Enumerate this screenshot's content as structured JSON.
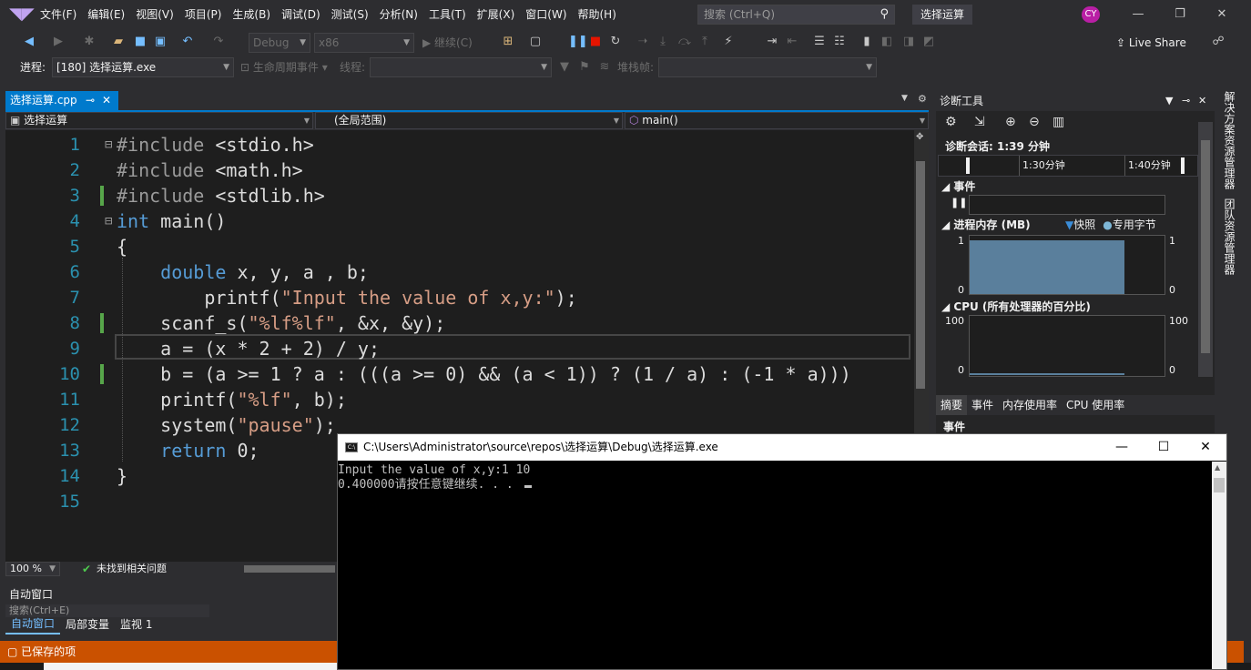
{
  "menubar": {
    "items": [
      "文件(F)",
      "编辑(E)",
      "视图(V)",
      "项目(P)",
      "生成(B)",
      "调试(D)",
      "测试(S)",
      "分析(N)",
      "工具(T)",
      "扩展(X)",
      "窗口(W)",
      "帮助(H)"
    ],
    "search_placeholder": "搜索 (Ctrl+Q)",
    "project_title": "选择运算",
    "user_initials": "CY"
  },
  "toolbar": {
    "config": "Debug",
    "platform": "x86",
    "continue_label": "继续(C)",
    "live_share": "Live Share"
  },
  "debug_location": {
    "process_label": "进程:",
    "process_value": "[180] 选择运算.exe",
    "lifecycle_label": "生命周期事件",
    "thread_label": "线程:",
    "stackframe_label": "堆栈帧:"
  },
  "editor": {
    "tab_name": "选择运算.cpp",
    "pin_glyph": "⊸",
    "close_glyph": "✕",
    "nav_project": "选择运算",
    "nav_scope": "(全局范围)",
    "nav_member": "main()",
    "zoom": "100 %",
    "issues": "未找到相关问题"
  },
  "code_lines": [
    {
      "n": "1",
      "segments": [
        {
          "t": "#include",
          "c": "pp"
        },
        {
          "t": " <stdio.h>",
          "c": "plain"
        }
      ]
    },
    {
      "n": "2",
      "segments": [
        {
          "t": "#include",
          "c": "pp"
        },
        {
          "t": " <math.h>",
          "c": "plain"
        }
      ]
    },
    {
      "n": "3",
      "segments": [
        {
          "t": "#include",
          "c": "pp"
        },
        {
          "t": " <stdlib.h>",
          "c": "plain"
        }
      ]
    },
    {
      "n": "4",
      "segments": [
        {
          "t": "int",
          "c": "kw"
        },
        {
          "t": " main()",
          "c": "plain"
        }
      ]
    },
    {
      "n": "5",
      "segments": [
        {
          "t": "{",
          "c": "plain"
        }
      ]
    },
    {
      "n": "6",
      "segments": [
        {
          "t": "    double",
          "c": "kw"
        },
        {
          "t": " x, y, a , b;",
          "c": "plain"
        }
      ]
    },
    {
      "n": "7",
      "segments": [
        {
          "t": "        printf(",
          "c": "plain"
        },
        {
          "t": "\"Input the value of x,y:\"",
          "c": "str"
        },
        {
          "t": ");",
          "c": "plain"
        }
      ]
    },
    {
      "n": "8",
      "segments": [
        {
          "t": "    scanf_s(",
          "c": "plain"
        },
        {
          "t": "\"%lf%lf\"",
          "c": "str"
        },
        {
          "t": ", &x, &y);",
          "c": "plain"
        }
      ]
    },
    {
      "n": "9",
      "segments": [
        {
          "t": "    a = (x * 2 + 2) / y;",
          "c": "plain"
        }
      ]
    },
    {
      "n": "10",
      "segments": [
        {
          "t": "    b = (a >= 1 ? a : (((a >= 0) && (a < 1)) ? (1 / a) : (-1 * a)))",
          "c": "plain"
        }
      ]
    },
    {
      "n": "11",
      "segments": [
        {
          "t": "    printf(",
          "c": "plain"
        },
        {
          "t": "\"%lf\"",
          "c": "str"
        },
        {
          "t": ", b);",
          "c": "plain"
        }
      ]
    },
    {
      "n": "12",
      "segments": [
        {
          "t": "    system(",
          "c": "plain"
        },
        {
          "t": "\"pause\"",
          "c": "str"
        },
        {
          "t": ");",
          "c": "plain"
        }
      ]
    },
    {
      "n": "13",
      "segments": [
        {
          "t": "    return",
          "c": "kw"
        },
        {
          "t": " 0;",
          "c": "plain"
        }
      ]
    },
    {
      "n": "14",
      "segments": [
        {
          "t": "}",
          "c": "plain"
        }
      ]
    },
    {
      "n": "15",
      "segments": []
    }
  ],
  "bottom": {
    "autos_title": "自动窗口",
    "search_placeholder": "搜索(Ctrl+E)",
    "tabs": [
      "自动窗口",
      "局部变量",
      "监视 1"
    ],
    "status": "已保存的项"
  },
  "diagnostics": {
    "title": "诊断工具",
    "session": "诊断会话: 1:39 分钟",
    "timeline_ticks": [
      "1:30分钟",
      "1:40分钟"
    ],
    "events_label": "事件",
    "memory_label": "进程内存 (MB)",
    "snapshot_legend": "快照",
    "private_legend": "专用字节",
    "memory_axis": {
      "max": "1",
      "min": "0"
    },
    "memory_level": 0.92,
    "cpu_label": "CPU (所有处理器的百分比)",
    "cpu_axis": {
      "max": "100",
      "min": "0"
    },
    "tabs": [
      "摘要",
      "事件",
      "内存使用率",
      "CPU 使用率"
    ],
    "lower_heading": "事件"
  },
  "side_panels": [
    "解决方案资源管理器",
    "团队资源管理器"
  ],
  "console": {
    "title": "C:\\Users\\Administrator\\source\\repos\\选择运算\\Debug\\选择运算.exe",
    "lines": [
      "Input the value of x,y:1 10",
      "0.400000请按任意键继续. . . "
    ]
  },
  "colors": {
    "accent": "#007acc",
    "status_bar": "#ca5100",
    "editor_bg": "#1e1e1e"
  }
}
